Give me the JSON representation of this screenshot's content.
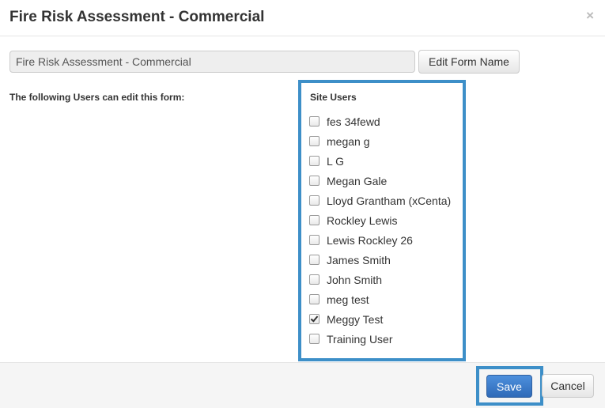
{
  "modal": {
    "title": "Fire Risk Assessment - Commercial",
    "close_glyph": "×"
  },
  "form_name": {
    "value": "Fire Risk Assessment - Commercial",
    "edit_button_label": "Edit Form Name"
  },
  "users_section": {
    "label": "The following Users can edit this form:",
    "site_users_title": "Site Users",
    "users": [
      {
        "name": "fes 34fewd",
        "checked": false
      },
      {
        "name": "megan g",
        "checked": false
      },
      {
        "name": "L G",
        "checked": false
      },
      {
        "name": "Megan Gale",
        "checked": false
      },
      {
        "name": "Lloyd Grantham (xCenta)",
        "checked": false
      },
      {
        "name": "Rockley Lewis",
        "checked": false
      },
      {
        "name": "Lewis Rockley 26",
        "checked": false
      },
      {
        "name": "James Smith",
        "checked": false
      },
      {
        "name": "John Smith",
        "checked": false
      },
      {
        "name": "meg test",
        "checked": false
      },
      {
        "name": "Meggy Test",
        "checked": true
      },
      {
        "name": "Training User",
        "checked": false
      }
    ]
  },
  "footer": {
    "save_label": "Save",
    "cancel_label": "Cancel"
  },
  "colors": {
    "highlight": "#3d8fc8",
    "primary_button": "#3a7bc8"
  },
  "icons": {
    "close": "close-icon",
    "checkbox": "checkbox-icon"
  }
}
